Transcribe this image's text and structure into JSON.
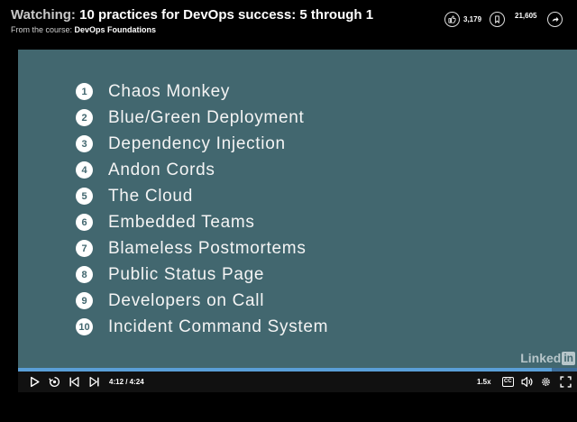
{
  "header": {
    "title_prefix": "Watching:",
    "title": "10 practices for DevOps success: 5 through 1",
    "course_prefix": "From the course:",
    "course_name": "DevOps Foundations",
    "likes": "3,179",
    "saves": "21,605"
  },
  "slide": {
    "items": [
      {
        "number": "1",
        "label": "Chaos Monkey"
      },
      {
        "number": "2",
        "label": "Blue/Green Deployment"
      },
      {
        "number": "3",
        "label": "Dependency Injection"
      },
      {
        "number": "4",
        "label": "Andon Cords"
      },
      {
        "number": "5",
        "label": "The Cloud"
      },
      {
        "number": "6",
        "label": "Embedded Teams"
      },
      {
        "number": "7",
        "label": "Blameless Postmortems"
      },
      {
        "number": "8",
        "label": "Public Status Page"
      },
      {
        "number": "9",
        "label": "Developers on Call"
      },
      {
        "number": "10",
        "label": "Incident Command System"
      }
    ],
    "logo_text": "Linked",
    "logo_in": "in",
    "background_color": "#42676f"
  },
  "player": {
    "time": "4:12 / 4:24",
    "progress": 0.9545,
    "speed": "1.5x",
    "cc_label": "CC",
    "icons": [
      "play-icon",
      "replay-icon",
      "previous-icon",
      "next-icon",
      "cc-icon",
      "volume-icon",
      "settings-icon",
      "fullscreen-icon"
    ],
    "progress_color": "#5a9fd8"
  }
}
